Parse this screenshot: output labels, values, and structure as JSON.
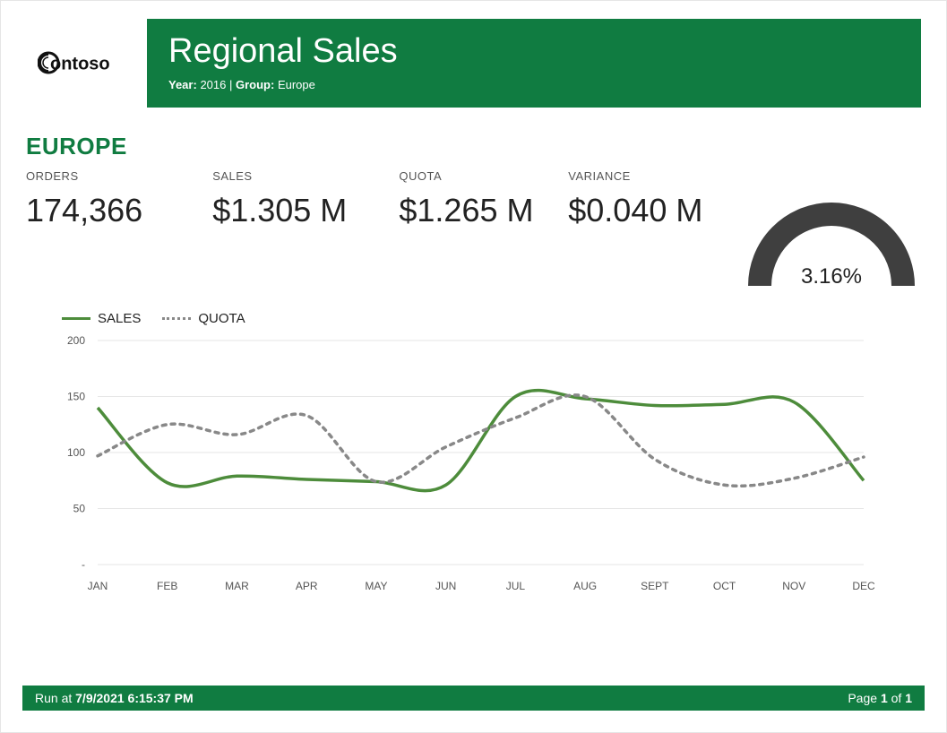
{
  "header": {
    "logo_text": "Contoso",
    "title": "Regional Sales",
    "year_label": "Year:",
    "year_value": "2016",
    "group_label": "Group:",
    "group_value": "Europe"
  },
  "region_title": "EUROPE",
  "kpis": {
    "orders": {
      "label": "ORDERS",
      "value": "174,366"
    },
    "sales": {
      "label": "SALES",
      "value": "$1.305 M"
    },
    "quota": {
      "label": "QUOTA",
      "value": "$1.265 M"
    },
    "variance": {
      "label": "VARIANCE",
      "value": "$0.040 M"
    }
  },
  "gauge": {
    "value_text": "3.16%",
    "percent": 3.16
  },
  "legend": {
    "sales": "SALES",
    "quota": "QUOTA"
  },
  "chart_data": {
    "type": "line",
    "title": "",
    "xlabel": "",
    "ylabel": "",
    "ylim": [
      0,
      200
    ],
    "yticks": [
      "-",
      "50",
      "100",
      "150",
      "200"
    ],
    "categories": [
      "JAN",
      "FEB",
      "MAR",
      "APR",
      "MAY",
      "JUN",
      "JUL",
      "AUG",
      "SEPT",
      "OCT",
      "NOV",
      "DEC"
    ],
    "series": [
      {
        "name": "SALES",
        "values": [
          140,
          73,
          79,
          76,
          74,
          71,
          150,
          148,
          142,
          143,
          145,
          75
        ]
      },
      {
        "name": "QUOTA",
        "values": [
          97,
          125,
          116,
          133,
          74,
          105,
          131,
          150,
          94,
          71,
          77,
          96
        ]
      }
    ]
  },
  "footer": {
    "run_label": "Run at",
    "run_text": "7/9/2021 6:15:37 PM",
    "page_label": "Page",
    "page_of": "of",
    "page_current": "1",
    "page_total": "1"
  },
  "colors": {
    "brand": "#107c41",
    "sales_line": "#4d8c3b",
    "quota_line": "#888888",
    "gauge": "#3f3f3f"
  }
}
